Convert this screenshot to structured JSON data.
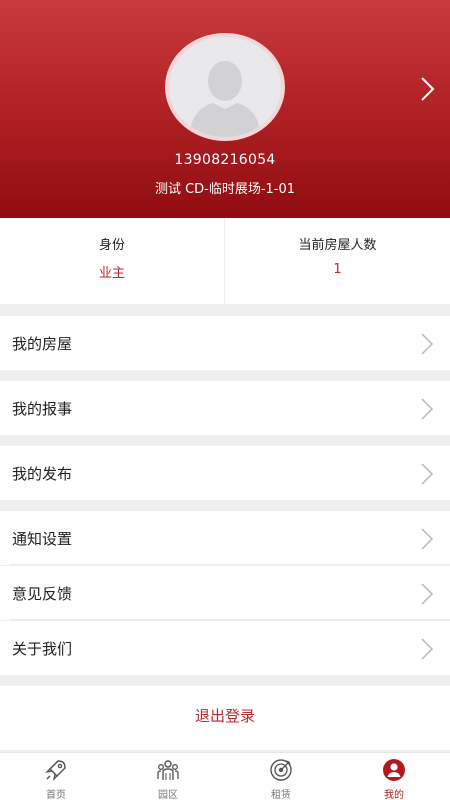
{
  "profile": {
    "phone": "13908216054",
    "address": "测试 CD-临时展场-1-01"
  },
  "stats": {
    "identity_label": "身份",
    "identity_value": "业主",
    "people_label": "当前房屋人数",
    "people_value": "1"
  },
  "menu": {
    "my_house": "我的房屋",
    "my_report": "我的报事",
    "my_post": "我的发布",
    "notify_settings": "通知设置",
    "feedback": "意见反馈",
    "about_us": "关于我们"
  },
  "logout_label": "退出登录",
  "tabs": [
    {
      "label": "首页",
      "icon": "rocket-icon",
      "active": false
    },
    {
      "label": "园区",
      "icon": "people-group-icon",
      "active": false
    },
    {
      "label": "租赁",
      "icon": "target-icon",
      "active": false
    },
    {
      "label": "我的",
      "icon": "user-circle-icon",
      "active": true
    }
  ],
  "colors": {
    "header_red": "#ae1f23",
    "accent": "#c0282c",
    "background": "#f0eef1"
  }
}
